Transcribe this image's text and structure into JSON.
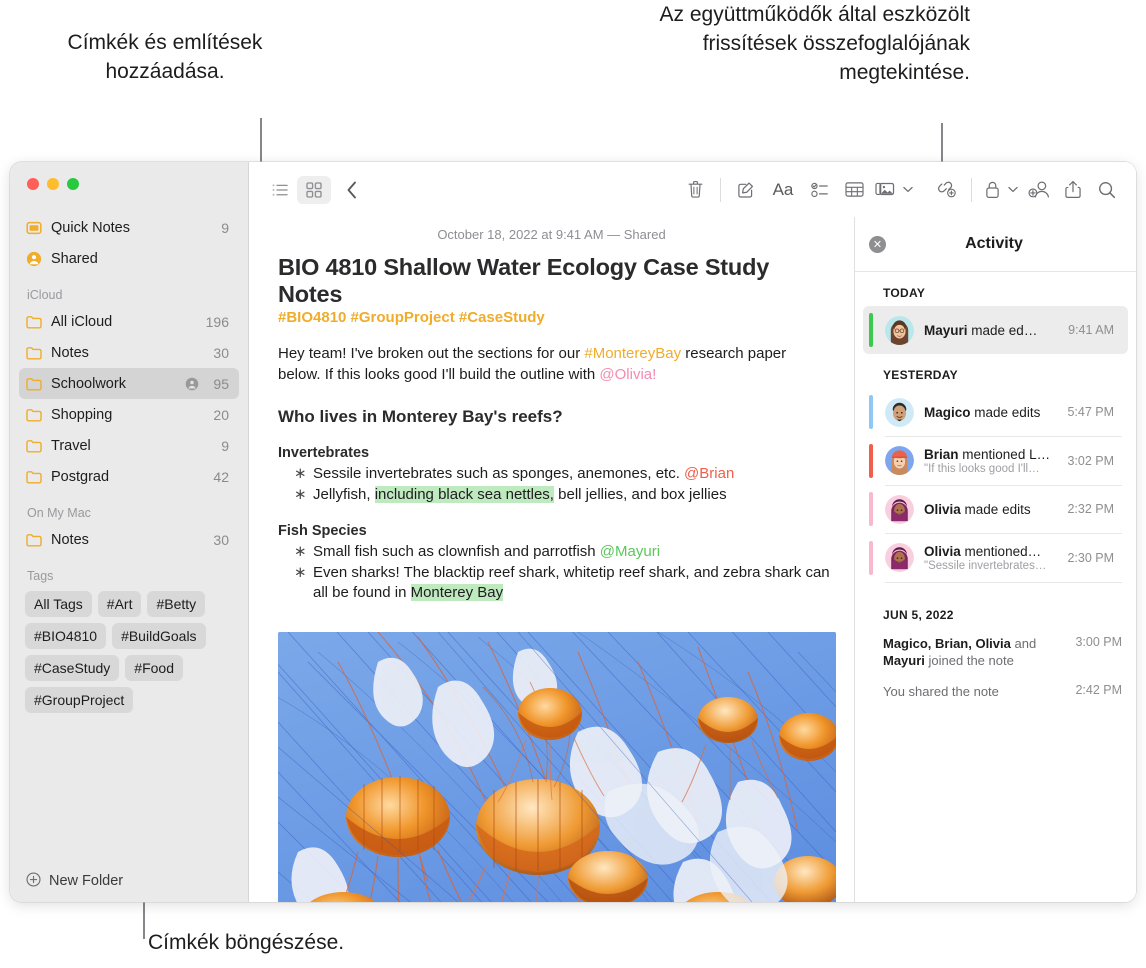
{
  "annotations": {
    "left": "Címkék és említések hozzáadása.",
    "right": "Az együttműködők által eszközölt frissítések összefoglalójának megtekintése.",
    "bottom": "Címkék böngészése."
  },
  "window": {
    "traffic": [
      "close",
      "minimize",
      "zoom"
    ]
  },
  "sidebar": {
    "top_items": [
      {
        "label": "Quick Notes",
        "count": "9",
        "icon": "quick-note-icon"
      },
      {
        "label": "Shared",
        "count": "",
        "icon": "shared-person-icon"
      }
    ],
    "groups": [
      {
        "title": "iCloud",
        "items": [
          {
            "label": "All iCloud",
            "count": "196",
            "icon": "folder-icon",
            "selected": false,
            "shared": false
          },
          {
            "label": "Notes",
            "count": "30",
            "icon": "folder-icon",
            "selected": false,
            "shared": false
          },
          {
            "label": "Schoolwork",
            "count": "95",
            "icon": "folder-icon",
            "selected": true,
            "shared": true
          },
          {
            "label": "Shopping",
            "count": "20",
            "icon": "folder-icon",
            "selected": false,
            "shared": false
          },
          {
            "label": "Travel",
            "count": "9",
            "icon": "folder-icon",
            "selected": false,
            "shared": false
          },
          {
            "label": "Postgrad",
            "count": "42",
            "icon": "folder-icon",
            "selected": false,
            "shared": false
          }
        ]
      },
      {
        "title": "On My Mac",
        "items": [
          {
            "label": "Notes",
            "count": "30",
            "icon": "folder-icon",
            "selected": false,
            "shared": false
          }
        ]
      }
    ],
    "tags_title": "Tags",
    "tags": [
      "All Tags",
      "#Art",
      "#Betty",
      "#BIO4810",
      "#BuildGoals",
      "#CaseStudy",
      "#Food",
      "#GroupProject"
    ],
    "new_folder": "New Folder"
  },
  "toolbar": {
    "list_view": "list-view-icon",
    "gallery_view": "gallery-view-icon",
    "back": "back-chevron-icon",
    "delete": "trash-icon",
    "compose": "compose-icon",
    "format": "format-aa-icon",
    "checklist": "checklist-icon",
    "table": "table-icon",
    "media": "media-icon",
    "media_chevron": "chevron-down-icon",
    "link": "link-add-icon",
    "lock": "lock-icon",
    "lock_chevron": "chevron-down-icon",
    "collaborate": "add-person-icon",
    "share": "share-icon",
    "search": "search-icon"
  },
  "note": {
    "date": "October 18, 2022 at 9:41 AM — Shared",
    "title": "BIO 4810 Shallow Water Ecology Case Study Notes",
    "tags_line": "#BIO4810 #GroupProject #CaseStudy",
    "intro": {
      "p1": "Hey team! I've broken out the sections for our ",
      "tag1": "#MontereyBay",
      "p2": " research paper below. If this looks good I'll build the outline with ",
      "mention1": "@Olivia!"
    },
    "heading": "Who lives in Monterey Bay's reefs?",
    "sections": [
      {
        "title": "Invertebrates",
        "bullets": [
          {
            "pre": "Sessile invertebrates such as sponges, anemones, etc. ",
            "mention": "@Brian",
            "mention_color": "red",
            "post": ""
          },
          {
            "pre": "Jellyfish, ",
            "highlight": "including black sea nettles,",
            "post": " bell jellies, and box jellies"
          }
        ]
      },
      {
        "title": "Fish Species",
        "bullets": [
          {
            "pre": "Small fish such as clownfish and parrotfish ",
            "mention": "@Mayuri",
            "mention_color": "green",
            "post": ""
          },
          {
            "pre": "Even sharks! The blacktip reef shark, whitetip reef shark, and zebra shark can all be found in ",
            "highlight": "Monterey Bay",
            "post": ""
          }
        ]
      }
    ],
    "image_alt": "jellyfish-photo"
  },
  "activity": {
    "title": "Activity",
    "close": "close-icon",
    "sections": [
      {
        "label": "TODAY",
        "items": [
          {
            "name": "Mayuri",
            "action": "made ed…",
            "quote": "",
            "time": "9:41 AM",
            "bar_color": "#3bc94f",
            "avatar": "mayuri",
            "selected": true
          }
        ]
      },
      {
        "label": "YESTERDAY",
        "items": [
          {
            "name": "Magico",
            "action": "made edits",
            "quote": "",
            "time": "5:47 PM",
            "bar_color": "#8fc8f5",
            "avatar": "magico",
            "selected": false
          },
          {
            "name": "Brian",
            "action": "mentioned L…",
            "quote": "\"If this looks good I'll…",
            "time": "3:02 PM",
            "bar_color": "#ef5f4b",
            "avatar": "brian",
            "selected": false
          },
          {
            "name": "Olivia",
            "action": "made edits",
            "quote": "",
            "time": "2:32 PM",
            "bar_color": "#f8b8d0",
            "avatar": "olivia",
            "selected": false
          },
          {
            "name": "Olivia",
            "action": "mentioned…",
            "quote": "\"Sessile invertebrates…",
            "time": "2:30 PM",
            "bar_color": "#f8b8d0",
            "avatar": "olivia",
            "selected": false
          }
        ]
      }
    ],
    "old_section": {
      "label": "JUN 5, 2022",
      "rows": [
        {
          "names": "Magico, Brian, Olivia",
          "rest": " and ",
          "names2": "Mayuri",
          "rest2": " joined the note",
          "time": "3:00 PM"
        },
        {
          "names": "",
          "rest": "You shared the note",
          "names2": "",
          "rest2": "",
          "time": "2:42 PM"
        }
      ]
    }
  },
  "colors": {
    "accent_orange": "#f0ac2b",
    "highlight_green": "#bfe9bf",
    "selected_row": "#d4d4d4",
    "sidebar_bg": "#eaeaea"
  }
}
